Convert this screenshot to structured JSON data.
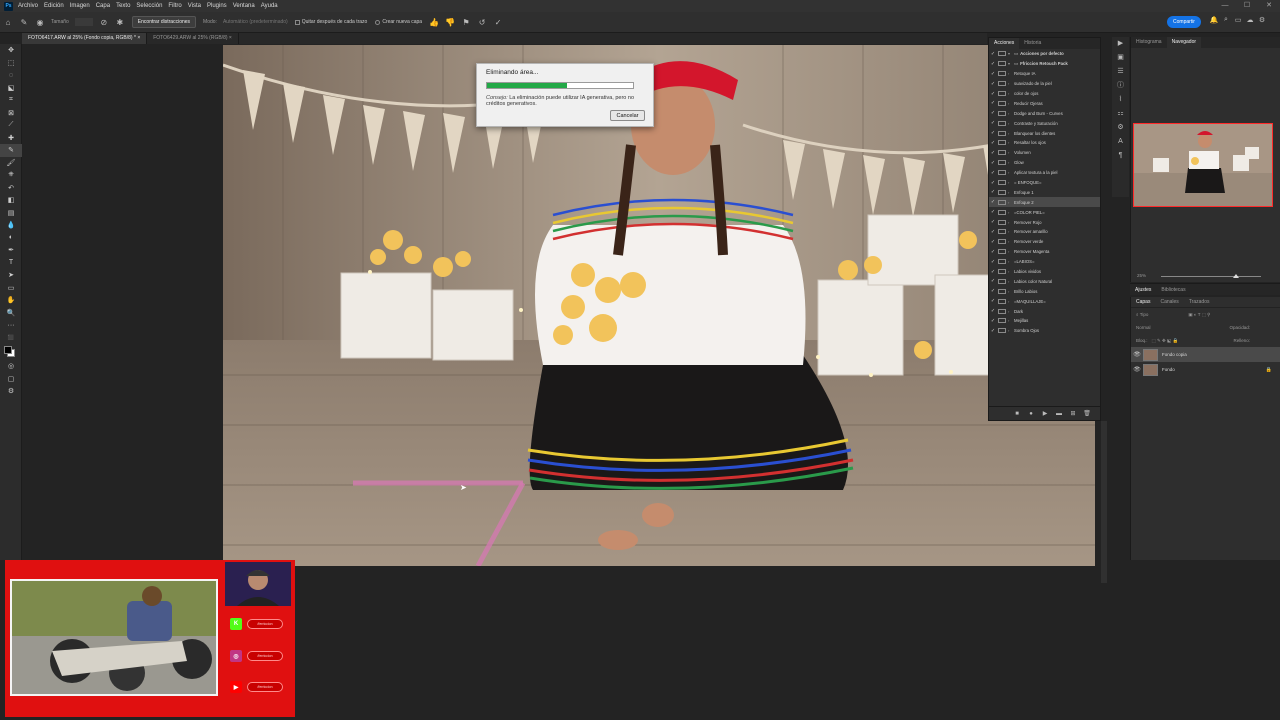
{
  "menu": {
    "logo": "Ps",
    "items": [
      "Archivo",
      "Edición",
      "Imagen",
      "Capa",
      "Texto",
      "Selección",
      "Filtro",
      "Vista",
      "Plugins",
      "Ventana",
      "Ayuda"
    ]
  },
  "options": {
    "size_label": "Tamaño",
    "find_distractions": "Encontrar distracciones",
    "mode_label": "Modo:",
    "mode_value": "Automático (predeterminado)",
    "remove_after_stroke": "Quitar después de cada trazo",
    "new_layer": "Crear nueva capa",
    "share": "Compartir"
  },
  "tabs": [
    {
      "label": "FOTO6417.ARW al 25% (Fondo copia, RGB/8) *",
      "active": true
    },
    {
      "label": "FOTO6429.ARW al 25% (RGB/8)",
      "active": false
    }
  ],
  "dialog": {
    "title": "Eliminando área...",
    "progress": 0.55,
    "tip_label": "Consejo:",
    "tip_text": "La eliminación puede utilizar IA generativa, pero no créditos generativos.",
    "cancel": "Cancelar"
  },
  "actions_panel": {
    "tabs": [
      "Acciones",
      "Historia"
    ],
    "rows": [
      {
        "label": "Acciones por defecto",
        "set": true,
        "sel": false
      },
      {
        "label": "Ffriccion Retouch Pack",
        "set": true,
        "sel": false
      },
      {
        "label": "Retoque IA",
        "set": false,
        "sel": false
      },
      {
        "label": "suavizado de la piel",
        "set": false,
        "sel": false
      },
      {
        "label": "color de ojos",
        "set": false,
        "sel": false
      },
      {
        "label": "Reducir Ojeras",
        "set": false,
        "sel": false
      },
      {
        "label": "Dodge and Burn - Curves",
        "set": false,
        "sel": false
      },
      {
        "label": "Contraste y Saturación",
        "set": false,
        "sel": false
      },
      {
        "label": "Blanquear los dientes",
        "set": false,
        "sel": false
      },
      {
        "label": "Resaltar los ojos",
        "set": false,
        "sel": false
      },
      {
        "label": "Volumen",
        "set": false,
        "sel": false
      },
      {
        "label": "Glow",
        "set": false,
        "sel": false
      },
      {
        "label": "Aplicar textura a la piel",
        "set": false,
        "sel": false
      },
      {
        "label": "= ENFOQUE=",
        "set": false,
        "sel": false
      },
      {
        "label": "Enfoque 1",
        "set": false,
        "sel": false
      },
      {
        "label": "Enfoque 2",
        "set": false,
        "sel": true
      },
      {
        "label": "=COLOR PIEL=",
        "set": false,
        "sel": false
      },
      {
        "label": "Remover Rojo",
        "set": false,
        "sel": false
      },
      {
        "label": "Remover amarillo",
        "set": false,
        "sel": false
      },
      {
        "label": "Remover verde",
        "set": false,
        "sel": false
      },
      {
        "label": "Remover Magenta",
        "set": false,
        "sel": false
      },
      {
        "label": "=LABIOS=",
        "set": false,
        "sel": false
      },
      {
        "label": "Labios vividos",
        "set": false,
        "sel": false
      },
      {
        "label": "Labios color Natural",
        "set": false,
        "sel": false
      },
      {
        "label": "Brillo Labios",
        "set": false,
        "sel": false
      },
      {
        "label": "=MAQUILLAJE=",
        "set": false,
        "sel": false
      },
      {
        "label": "Dark",
        "set": false,
        "sel": false
      },
      {
        "label": "Mejillas",
        "set": false,
        "sel": false
      },
      {
        "label": "Sombra Ojos",
        "set": false,
        "sel": false
      }
    ]
  },
  "navigator": {
    "tabs": [
      "Histograma",
      "Navegador"
    ],
    "zoom": "25%"
  },
  "adjustments": {
    "tabs": [
      "Ajustes",
      "Bibliotecas"
    ]
  },
  "layers_panel": {
    "tabs": [
      "Capas",
      "Canales",
      "Trazados"
    ],
    "search": "Tipo",
    "blend": "Normal",
    "opacity_label": "Opacidad:",
    "lock_label": "Bloq.:",
    "fill_label": "Relleno:",
    "layers": [
      {
        "name": "Fondo copia",
        "sel": true,
        "locked": false
      },
      {
        "name": "Fondo",
        "sel": false,
        "locked": true
      }
    ]
  },
  "overlay": {
    "socials": [
      {
        "icon": "K",
        "color": "#53fc18",
        "label": "/ferriccion"
      },
      {
        "icon": "◎",
        "color": "#c13584",
        "label": "/ferriccion"
      },
      {
        "icon": "▶",
        "color": "#ff0000",
        "label": "/ferriccion"
      }
    ]
  }
}
